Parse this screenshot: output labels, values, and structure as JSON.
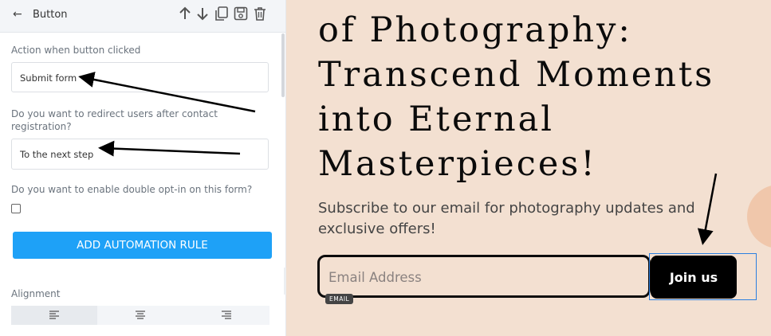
{
  "sidebar": {
    "title": "Button",
    "header_icons": [
      "arrow-up-icon",
      "arrow-down-icon",
      "copy-icon",
      "save-icon",
      "trash-icon"
    ],
    "action_label": "Action when button clicked",
    "action_value": "Submit form",
    "redirect_label": "Do you want to redirect users after contact registration?",
    "redirect_value": "To the next step",
    "optin_label": "Do you want to enable double opt-in on this form?",
    "optin_checked": false,
    "automation_button": "ADD AUTOMATION RULE",
    "alignment_label": "Alignment",
    "alignment_options": [
      "align-left-icon",
      "align-center-icon",
      "align-right-icon"
    ],
    "alignment_selected": "left"
  },
  "canvas": {
    "heading_lines": [
      "of Photography:",
      "Transcend Moments",
      "into Eternal",
      "Masterpieces!"
    ],
    "subtext": "Subscribe to our email for photography updates and exclusive offers!",
    "email_placeholder": "Email Address",
    "email_tag": "EMAIL",
    "join_button": "Join us"
  },
  "colors": {
    "accent": "#1ea1f7",
    "canvas_bg": "#f3e0d1",
    "selection_outline": "#2a7fe0"
  }
}
